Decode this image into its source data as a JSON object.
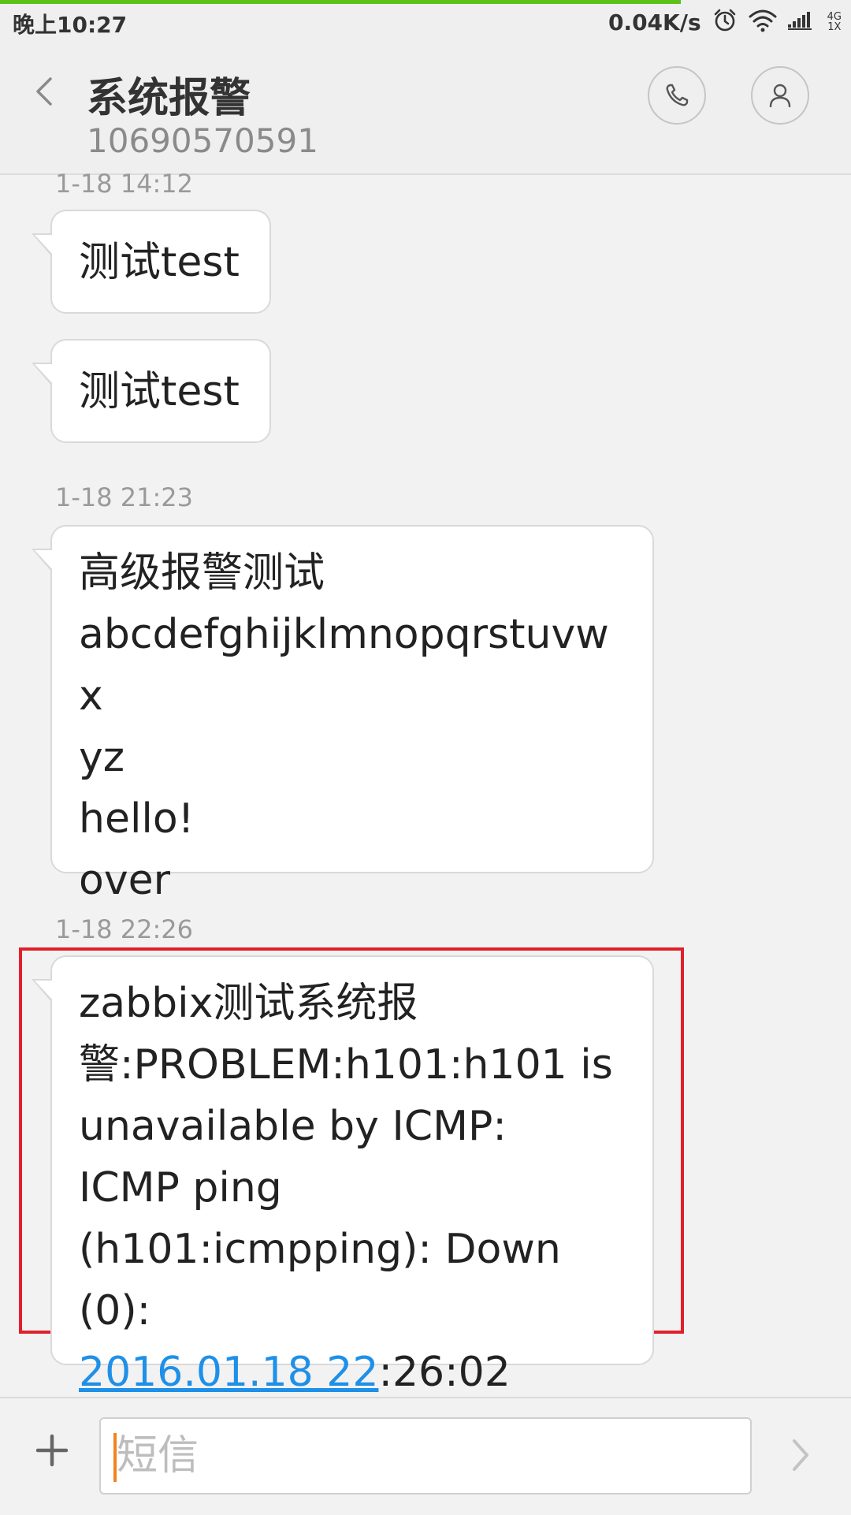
{
  "status_bar": {
    "time": "晚上10:27",
    "net_speed": "0.04K/s",
    "net_type_top": "4G",
    "net_type_bottom": "1X",
    "page_load_progress": 0.8,
    "icons": [
      "alarm-icon",
      "wifi-icon",
      "signal-icon"
    ]
  },
  "header": {
    "contact_name": "系统报警",
    "contact_number": "10690570591",
    "icons": [
      "back-arrow-icon",
      "phone-icon",
      "contact-icon"
    ]
  },
  "messages": [
    {
      "timestamp": "1-18 14:12",
      "text": "测试test"
    },
    {
      "timestamp": "",
      "text": "测试test"
    },
    {
      "timestamp": "1-18 21:23",
      "text": "高级报警测试\nabcdefghijklmnopqrstuvwx\nyz\nhello!\nover"
    },
    {
      "timestamp": "1-18 22:26",
      "text_before_link": "zabbix测试系统报\n警:PROBLEM:h101:h101 is\nunavailable by ICMP:\nICMP ping\n(h101:icmpping): Down (0):\n",
      "link_text": "2016.01.18 22",
      "text_after_link": ":26:02",
      "highlighted": true
    }
  ],
  "composer": {
    "placeholder": "短信",
    "icons": [
      "plus-icon",
      "send-icon"
    ]
  },
  "colors": {
    "highlight_border": "#e0202a",
    "link": "#1e90e8",
    "progress": "#5cc21a",
    "cursor": "#f0851e"
  }
}
